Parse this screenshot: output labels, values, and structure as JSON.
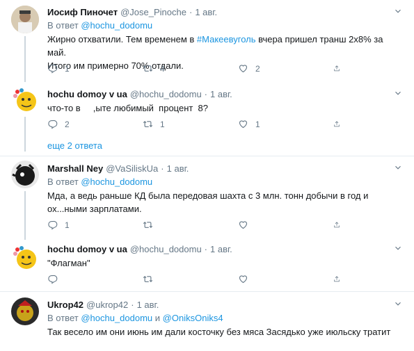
{
  "tweets": [
    {
      "name": "Иосиф Пиночет",
      "handle": "@Jose_Pinoche",
      "dot": "·",
      "date": "1 авг.",
      "reply_prefix": "В ответ",
      "reply_users": [
        "@hochu_dodomu"
      ],
      "text_before": "Жирно отхватили. Тем временем в ",
      "text_link": "#Макеевуголь",
      "text_after": " вчера пришел транш 2х8% за май.",
      "text_line2": "Итого им примерно 70% отдали.",
      "counts": {
        "reply": "1",
        "retweet": "4",
        "like": "2"
      }
    },
    {
      "name": "hochu domoy v ua",
      "handle": "@hochu_dodomu",
      "dot": "·",
      "date": "1 авг.",
      "text": "что-то в     ,ыте любимый  процент  8?",
      "counts": {
        "reply": "2",
        "retweet": "1",
        "like": "1"
      }
    },
    {
      "name": "Marshall Ney",
      "handle": "@VaSiliskUa",
      "dot": "·",
      "date": "1 авг.",
      "reply_prefix": "В ответ",
      "reply_users": [
        "@hochu_dodomu"
      ],
      "text": "Мда, а ведь раньше КД была передовая шахта с 3 млн. тонн добычи в год и ох...ными зарплатами.",
      "counts": {
        "reply": "1",
        "retweet": "",
        "like": ""
      }
    },
    {
      "name": "hochu domoy v ua",
      "handle": "@hochu_dodomu",
      "dot": "·",
      "date": "1 авг.",
      "text": "\"Флагман\"",
      "counts": {
        "reply": "",
        "retweet": "",
        "like": ""
      }
    },
    {
      "name": "Ukrop42",
      "handle": "@ukrop42",
      "dot": "·",
      "date": "1 авг.",
      "reply_prefix": "В ответ",
      "reply_users": [
        "@hochu_dodomu",
        "@OniksOniks4"
      ],
      "reply_and": "и",
      "text": "Так весело им они июнь им дали косточку без мяса Засядько уже июльску тратит"
    }
  ],
  "more_replies": "еще 2 ответа",
  "icons": {
    "reply": "reply-icon",
    "retweet": "retweet-icon",
    "like": "like-icon",
    "share": "share-icon",
    "caret": "chevron-down-icon"
  },
  "colors": {
    "link": "#1b95e0",
    "muted": "#657786",
    "divider": "#e6ecf0",
    "thread": "#ccd6dd"
  }
}
